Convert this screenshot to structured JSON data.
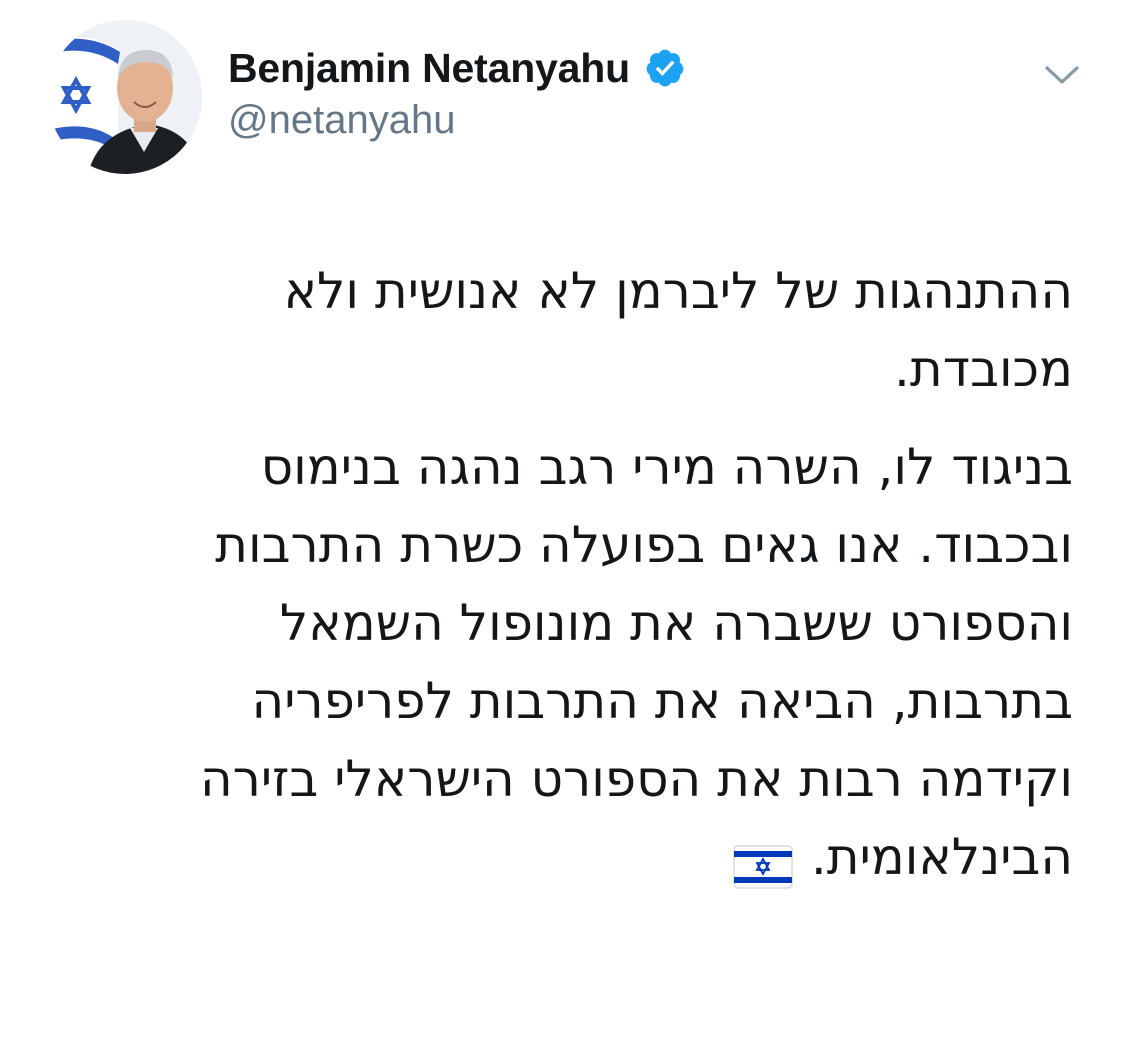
{
  "tweet": {
    "author": {
      "display_name": "Benjamin Netanyahu",
      "handle": "@netanyahu",
      "verified": true
    },
    "menu_icon": "chevron-down-icon",
    "paragraphs": [
      {
        "lines": [
          "ההתנהגות של ליברמן לא אנושית ולא",
          "מכובדת."
        ]
      },
      {
        "lines": [
          "בניגוד לו, השרה מירי רגב נהגה בנימוס",
          "ובכבוד. אנו גאים בפועלה כשרת התרבות",
          "והספורט ששברה את מונופול השמאל",
          "בתרבות, הביאה את התרבות לפריפריה",
          "וקידמה רבות את הספורט הישראלי בזירה",
          "הבינלאומית."
        ]
      }
    ],
    "trailing_emoji": "israel-flag-emoji"
  },
  "colors": {
    "text": "#14171a",
    "secondary_text": "#657786",
    "verified_badge": "#1da1f2",
    "flag_blue": "#0038b8"
  }
}
